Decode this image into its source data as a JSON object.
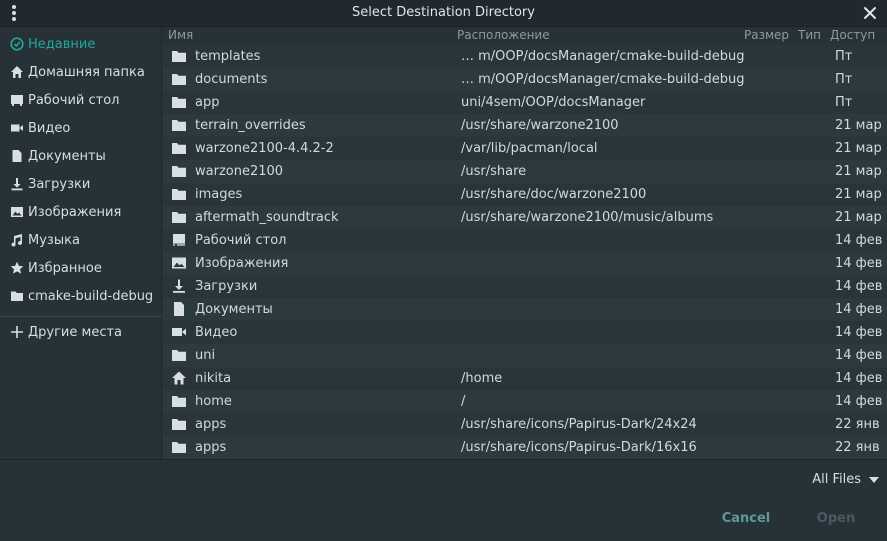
{
  "window": {
    "title": "Select Destination Directory"
  },
  "sidebar": {
    "items": [
      {
        "label": "Недавние",
        "icon": "clock-icon"
      },
      {
        "label": "Домашняя папка",
        "icon": "home-icon"
      },
      {
        "label": "Рабочий стол",
        "icon": "desktop-icon"
      },
      {
        "label": "Видео",
        "icon": "video-icon"
      },
      {
        "label": "Документы",
        "icon": "document-icon"
      },
      {
        "label": "Загрузки",
        "icon": "download-icon"
      },
      {
        "label": "Изображения",
        "icon": "image-icon"
      },
      {
        "label": "Музыка",
        "icon": "music-icon"
      },
      {
        "label": "Избранное",
        "icon": "star-icon"
      },
      {
        "label": "cmake-build-debug",
        "icon": "folder-icon"
      }
    ],
    "other_places": "Другие места"
  },
  "columns": {
    "name": "Имя",
    "location": "Расположение",
    "size": "Размер",
    "type": "Тип",
    "access": "Доступ"
  },
  "rows": [
    {
      "name": "templates",
      "location": "… m/OOP/docsManager/cmake-build-debug",
      "access": "Пт",
      "icon": "folder-icon"
    },
    {
      "name": "documents",
      "location": "… m/OOP/docsManager/cmake-build-debug",
      "access": "Пт",
      "icon": "folder-icon"
    },
    {
      "name": "app",
      "location": "uni/4sem/OOP/docsManager",
      "access": "Пт",
      "icon": "folder-icon"
    },
    {
      "name": "terrain_overrides",
      "location": "/usr/share/warzone2100",
      "access": "21 мар",
      "icon": "folder-icon"
    },
    {
      "name": "warzone2100-4.4.2-2",
      "location": "/var/lib/pacman/local",
      "access": "21 мар",
      "icon": "folder-icon"
    },
    {
      "name": "warzone2100",
      "location": "/usr/share",
      "access": "21 мар",
      "icon": "folder-icon"
    },
    {
      "name": "images",
      "location": "/usr/share/doc/warzone2100",
      "access": "21 мар",
      "icon": "folder-icon"
    },
    {
      "name": "aftermath_soundtrack",
      "location": "/usr/share/warzone2100/music/albums",
      "access": "21 мар",
      "icon": "folder-icon"
    },
    {
      "name": "Рабочий стол",
      "location": "",
      "access": "14 фев",
      "icon": "desktop-icon"
    },
    {
      "name": "Изображения",
      "location": "",
      "access": "14 фев",
      "icon": "image-icon"
    },
    {
      "name": "Загрузки",
      "location": "",
      "access": "14 фев",
      "icon": "download-icon"
    },
    {
      "name": "Документы",
      "location": "",
      "access": "14 фев",
      "icon": "document-icon"
    },
    {
      "name": "Видео",
      "location": "",
      "access": "14 фев",
      "icon": "video-icon"
    },
    {
      "name": "uni",
      "location": "",
      "access": "14 фев",
      "icon": "folder-icon"
    },
    {
      "name": "nikita",
      "location": "/home",
      "access": "14 фев",
      "icon": "home-icon"
    },
    {
      "name": "home",
      "location": "/",
      "access": "14 фев",
      "icon": "folder-icon"
    },
    {
      "name": "apps",
      "location": "/usr/share/icons/Papirus-Dark/24x24",
      "access": "22 янв",
      "icon": "folder-icon"
    },
    {
      "name": "apps",
      "location": "/usr/share/icons/Papirus-Dark/16x16",
      "access": "22 янв",
      "icon": "folder-icon"
    }
  ],
  "footer": {
    "filter": "All Files",
    "cancel": "Cancel",
    "open": "Open"
  },
  "colors": {
    "accent": "#26a69a",
    "background": "#263238",
    "list_background": "#29353b"
  }
}
